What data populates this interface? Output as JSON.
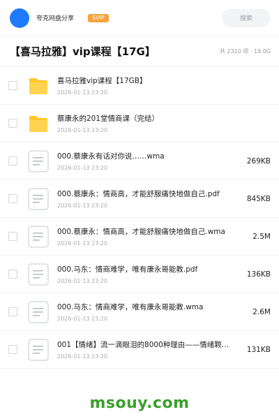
{
  "header": {
    "username": "夸克网盘分享",
    "badge": "SVIP",
    "search_placeholder": "搜索"
  },
  "folder": {
    "title": "【喜马拉雅】vip课程【17G】",
    "summary": "共 2310 项 · 18.0G"
  },
  "files": [
    {
      "type": "folder",
      "name": "喜马拉雅vip课程【17GB】",
      "date": "2026-01-13 23:20",
      "size": ""
    },
    {
      "type": "folder",
      "name": "蔡康永的201堂情商课（完结）",
      "date": "2026-01-13 23:20",
      "size": ""
    },
    {
      "type": "doc",
      "name": "000.蔡康永有话对你说……wma",
      "date": "2026-01-13 23:20",
      "size": "269KB"
    },
    {
      "type": "doc",
      "name": "000.蔡康永：情商高，才能舒服痛快地做自己.pdf",
      "date": "2026-01-13 23:20",
      "size": "845KB"
    },
    {
      "type": "doc",
      "name": "000.蔡康永：情商高，才能舒服痛快地做自己.wma",
      "date": "2026-01-13 23:20",
      "size": "2.5M"
    },
    {
      "type": "doc",
      "name": "000.马东：情商难学，唯有康永哥能教.pdf",
      "date": "2026-01-13 23:20",
      "size": "136KB"
    },
    {
      "type": "doc",
      "name": "000.马东：情商难学，唯有康永哥能教.wma",
      "date": "2026-01-13 23:20",
      "size": "2.6M"
    },
    {
      "type": "doc",
      "name": "001【情绪】流一滴眼泪的8000种理由——情绪颗…",
      "date": "2026-01-13 23:20",
      "size": "131KB"
    }
  ],
  "watermark": "msouy.com",
  "colors": {
    "accent": "#1e7bff",
    "svip": "#f7a23a",
    "folder": "#ffc72c",
    "watermark": "#3aa02a"
  }
}
